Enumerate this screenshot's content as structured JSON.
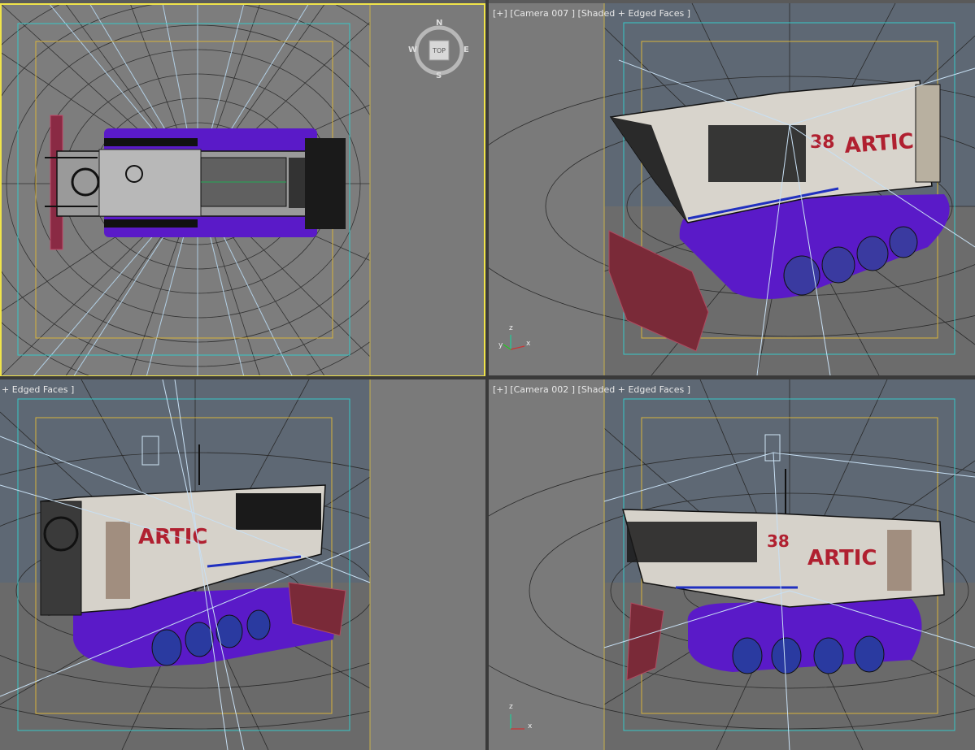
{
  "viewports": {
    "top": {
      "name": "Top",
      "viewcube": {
        "face": "TOP",
        "n": "N",
        "s": "S",
        "e": "E",
        "w": "W"
      }
    },
    "camera007": {
      "label": "[+] [Camera 007 ] [Shaded + Edged Faces ]"
    },
    "left": {
      "label": "+ Edged Faces ]"
    },
    "camera002": {
      "label": "[+] [Camera 002 ] [Shaded + Edged Faces ]"
    }
  },
  "model": {
    "brand_text": "ARTIC",
    "number": "38"
  },
  "axis": {
    "x": "x",
    "y": "y",
    "z": "z"
  },
  "colors": {
    "active_border": "#f0e44a",
    "safe_frame_outer": "#37c7c7",
    "safe_frame_inner": "#d8b33c",
    "track_purple": "#5a1ac8",
    "plow_red": "#8a2a3a",
    "logo_red": "#b02030"
  }
}
